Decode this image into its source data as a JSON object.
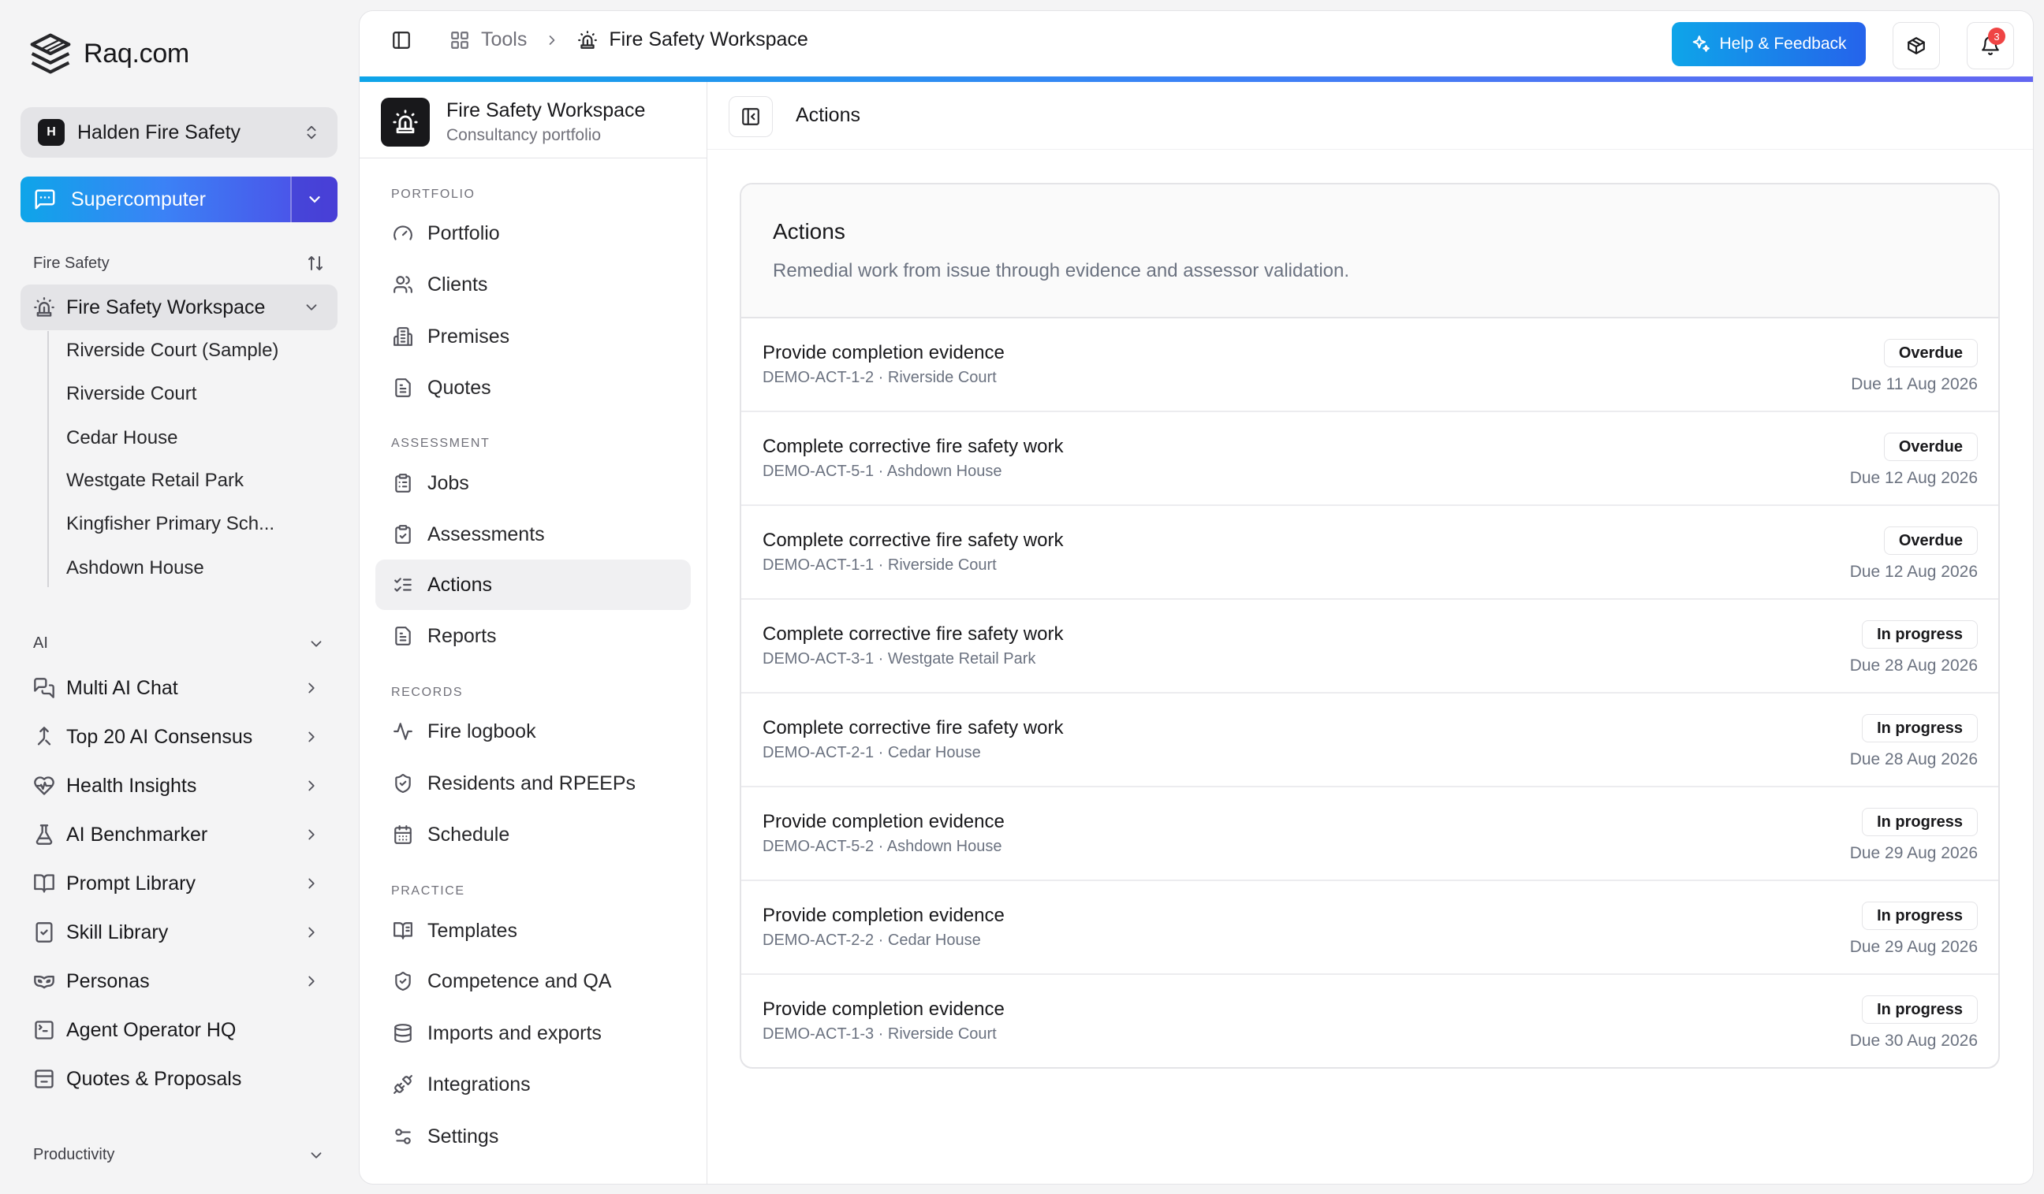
{
  "brand": {
    "name": "Raq.com"
  },
  "org": {
    "initial": "H",
    "name": "Halden Fire Safety"
  },
  "supercomputer": {
    "label": "Supercomputer"
  },
  "sidebar": {
    "fire_safety": {
      "title": "Fire Safety",
      "workspace_label": "Fire Safety Workspace",
      "sites": [
        "Riverside Court (Sample)",
        "Riverside Court",
        "Cedar House",
        "Westgate Retail Park",
        "Kingfisher Primary Sch...",
        "Ashdown House"
      ]
    },
    "ai": {
      "title": "AI",
      "items": [
        {
          "label": "Multi AI Chat",
          "icon": "chat-bubbles-icon"
        },
        {
          "label": "Top 20 AI Consensus",
          "icon": "merge-icon"
        },
        {
          "label": "Health Insights",
          "icon": "heart-pulse-icon"
        },
        {
          "label": "AI Benchmarker",
          "icon": "flask-icon"
        },
        {
          "label": "Prompt Library",
          "icon": "book-open-icon"
        },
        {
          "label": "Skill Library",
          "icon": "notebook-icon"
        },
        {
          "label": "Personas",
          "icon": "drama-mask-icon"
        },
        {
          "label": "Agent Operator HQ",
          "icon": "terminal-square-icon"
        },
        {
          "label": "Quotes & Proposals",
          "icon": "inbox-icon"
        }
      ]
    },
    "productivity": {
      "title": "Productivity"
    }
  },
  "topbar": {
    "crumb_tools": "Tools",
    "crumb_workspace": "Fire Safety Workspace",
    "help_label": "Help & Feedback",
    "notif_count": "3"
  },
  "workspace": {
    "title": "Fire Safety Workspace",
    "subtitle": "Consultancy portfolio",
    "groups": {
      "portfolio": "PORTFOLIO",
      "assessment": "ASSESSMENT",
      "records": "RECORDS",
      "practice": "PRACTICE"
    },
    "nav": {
      "portfolio": "Portfolio",
      "clients": "Clients",
      "premises": "Premises",
      "quotes": "Quotes",
      "jobs": "Jobs",
      "assessments": "Assessments",
      "actions": "Actions",
      "reports": "Reports",
      "fire_logbook": "Fire logbook",
      "residents": "Residents and RPEEPs",
      "schedule": "Schedule",
      "templates": "Templates",
      "competence": "Competence and QA",
      "imports": "Imports and exports",
      "integrations": "Integrations",
      "settings": "Settings"
    }
  },
  "content": {
    "header_title": "Actions",
    "card_title": "Actions",
    "card_description": "Remedial work from issue through evidence and assessor validation.",
    "rows": [
      {
        "title": "Provide completion evidence",
        "meta": "DEMO-ACT-1-2 · Riverside Court",
        "status": "Overdue",
        "due": "Due 11 Aug 2026"
      },
      {
        "title": "Complete corrective fire safety work",
        "meta": "DEMO-ACT-5-1 · Ashdown House",
        "status": "Overdue",
        "due": "Due 12 Aug 2026"
      },
      {
        "title": "Complete corrective fire safety work",
        "meta": "DEMO-ACT-1-1 · Riverside Court",
        "status": "Overdue",
        "due": "Due 12 Aug 2026"
      },
      {
        "title": "Complete corrective fire safety work",
        "meta": "DEMO-ACT-3-1 · Westgate Retail Park",
        "status": "In progress",
        "due": "Due 28 Aug 2026"
      },
      {
        "title": "Complete corrective fire safety work",
        "meta": "DEMO-ACT-2-1 · Cedar House",
        "status": "In progress",
        "due": "Due 28 Aug 2026"
      },
      {
        "title": "Provide completion evidence",
        "meta": "DEMO-ACT-5-2 · Ashdown House",
        "status": "In progress",
        "due": "Due 29 Aug 2026"
      },
      {
        "title": "Provide completion evidence",
        "meta": "DEMO-ACT-2-2 · Cedar House",
        "status": "In progress",
        "due": "Due 29 Aug 2026"
      },
      {
        "title": "Provide completion evidence",
        "meta": "DEMO-ACT-1-3 · Riverside Court",
        "status": "In progress",
        "due": "Due 30 Aug 2026"
      }
    ]
  },
  "colors": {
    "accent_start": "#0ea5e9",
    "accent_end": "#4f46e5",
    "badge": "#ef4444"
  }
}
